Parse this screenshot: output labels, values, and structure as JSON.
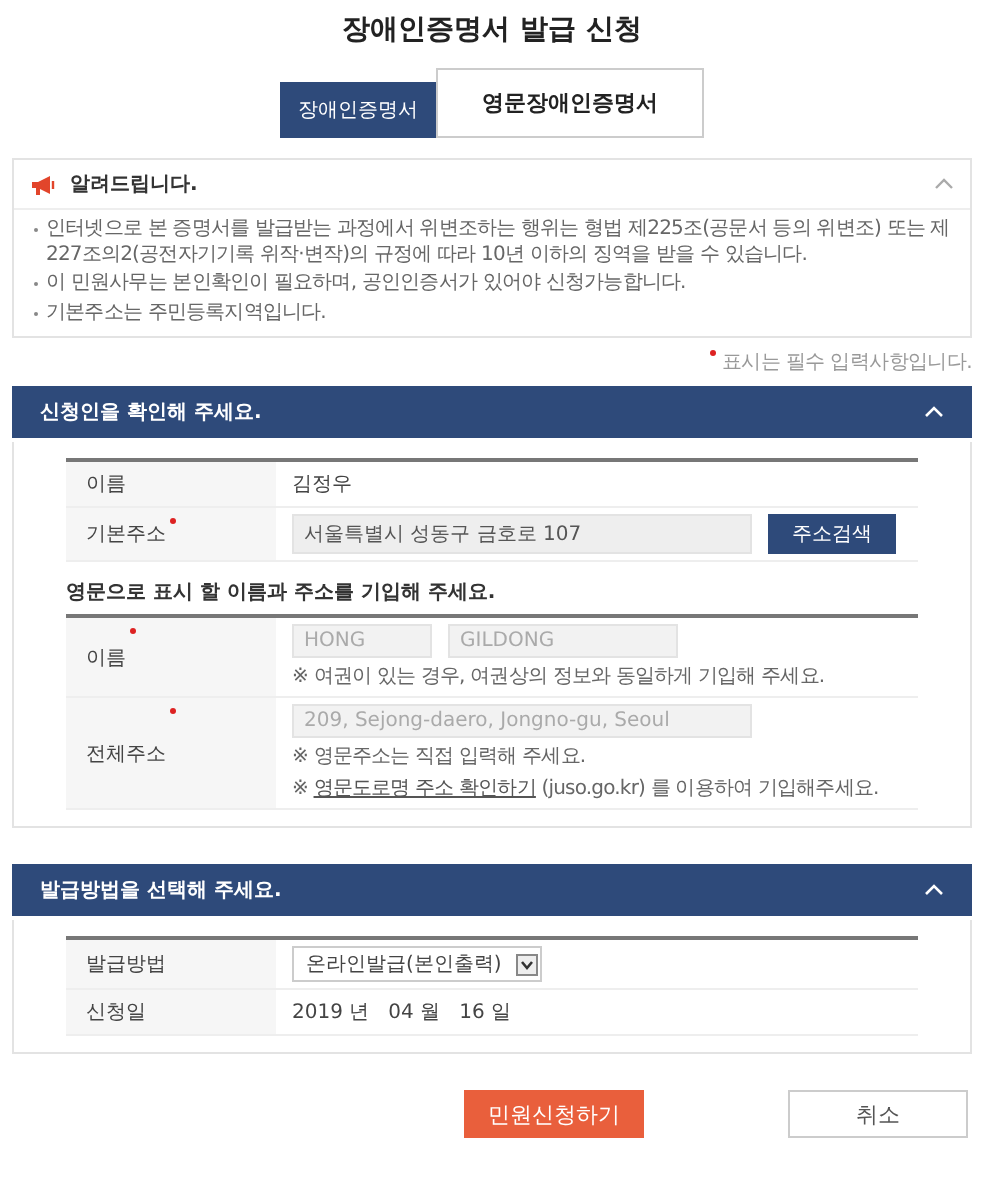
{
  "page_title": "장애인증명서 발급 신청",
  "tabs": [
    {
      "label": "장애인증명서",
      "selected": false
    },
    {
      "label": "영문장애인증명서",
      "selected": true
    }
  ],
  "notice": {
    "title": "알려드립니다.",
    "expanded": true,
    "items": [
      "인터넷으로 본 증명서를 발급받는 과정에서 위변조하는 행위는 형법 제225조(공문서 등의 위변조) 또는 제 227조의2(공전자기기록 위작·변작)의 규정에 따라 10년 이하의 징역을 받을 수 있습니다.",
      "이 민원사무는 본인확인이 필요하며, 공인인증서가 있어야 신청가능합니다.",
      "기본주소는 주민등록지역입니다."
    ]
  },
  "required_note": "표시는 필수 입력사항입니다.",
  "applicant": {
    "title": "신청인을 확인해 주세요.",
    "expanded": true,
    "rows": [
      {
        "kind": "text",
        "label": "이름",
        "required": false,
        "value": "김정우"
      },
      {
        "kind": "address",
        "label": "기본주소",
        "required": true,
        "value": "서울특별시 성동구 금호로 107",
        "button": "주소검색"
      }
    ],
    "english_heading": "영문으로 표시 할 이름과 주소를 기입해 주세요.",
    "english_rows": [
      {
        "kind": "name",
        "label": "이름",
        "required": true,
        "placeholders": [
          "HONG",
          "GILDONG"
        ],
        "notes": [
          {
            "text": "※ 여권이 있는 경우, 여권상의 정보와 동일하게 기입해 주세요."
          }
        ]
      },
      {
        "kind": "address",
        "label": "전체주소",
        "required": true,
        "placeholders": [
          "209, Sejong-daero, Jongno-gu, Seoul"
        ],
        "notes": [
          {
            "text": "※ 영문주소는 직접 입력해 주세요."
          },
          {
            "prefix": "※ ",
            "link": "영문도로명 주소 확인하기",
            "text": " (juso.go.kr) 를 이용하여 기입해주세요."
          }
        ]
      }
    ]
  },
  "issue": {
    "title": "발급방법을 선택해 주세요.",
    "expanded": true,
    "rows": [
      {
        "kind": "select",
        "label": "발급방법",
        "value": "온라인발급(본인출력)"
      },
      {
        "kind": "text",
        "label": "신청일",
        "value": "2019 년   04 월   16 일"
      }
    ]
  },
  "buttons": [
    {
      "kind": "primary",
      "label": "민원신청하기"
    },
    {
      "kind": "secondary",
      "label": "취소"
    }
  ]
}
